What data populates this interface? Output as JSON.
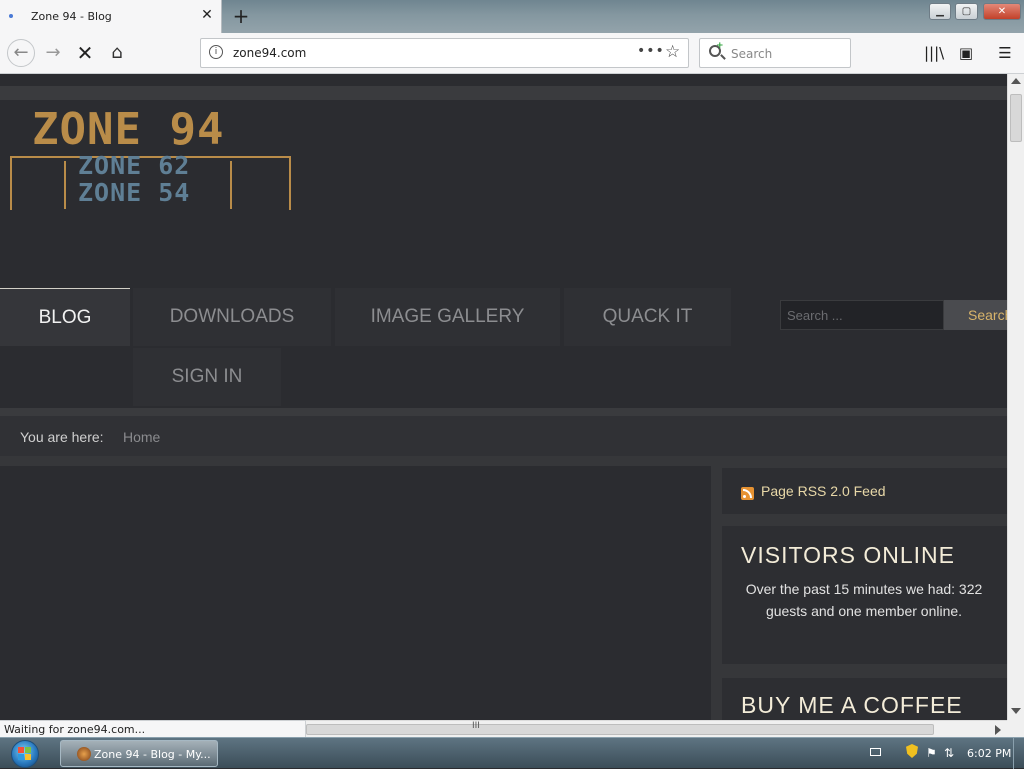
{
  "browser": {
    "tab_title": "Zone 94 - Blog",
    "tab_close": "✕",
    "new_tab": "+",
    "url": "zone94.com",
    "url_info": "i",
    "page_actions": "•••",
    "bookmark_star": "☆",
    "search_placeholder": "Search",
    "status_text": "Waiting for zone94.com...",
    "window_buttons": {
      "minimize": "▁",
      "maximize": "▢",
      "close": "✕"
    }
  },
  "site": {
    "logo": {
      "line1": "ZONE 94",
      "line2": "ZONE 62",
      "line3": "ZONE 54"
    },
    "menu": [
      {
        "label": "BLOG"
      },
      {
        "label": "DOWNLOADS"
      },
      {
        "label": "IMAGE GALLERY"
      },
      {
        "label": "QUACK IT"
      },
      {
        "label": "SIGN IN"
      }
    ],
    "search": {
      "placeholder": "Search ...",
      "button": "Search"
    },
    "breadcrumb": {
      "label": "You are here:",
      "current": "Home"
    },
    "sidebar": {
      "rss_text": "Page RSS 2.0 Feed",
      "visitors_title": "VISITORS ONLINE",
      "visitors_body": "Over the past 15 minutes we had: 322 guests and one member online.",
      "coffee_title": "BUY ME A COFFEE"
    }
  },
  "taskbar": {
    "task_label": "Zone 94 - Blog - My...",
    "clock": "6:02 PM"
  },
  "colors": {
    "accent_gold": "#b98c49",
    "logo_blue": "#5f7f95",
    "page_bg": "#2b2c30",
    "widget_title": "#f3ecd8"
  },
  "icons": [
    "back-arrow-icon",
    "forward-arrow-icon",
    "stop-icon",
    "home-icon",
    "info-icon",
    "star-icon",
    "search-icon",
    "library-icon",
    "sidebar-icon",
    "hamburger-menu-icon",
    "rss-icon",
    "windows-start-icon",
    "firefox-icon",
    "keyboard-icon",
    "shield-icon",
    "flag-icon",
    "network-icon"
  ]
}
